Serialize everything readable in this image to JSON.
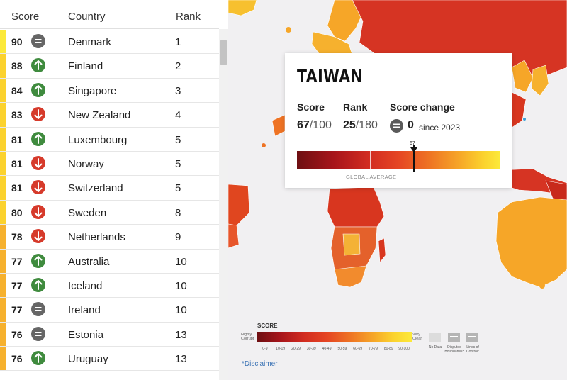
{
  "list": {
    "headers": {
      "score": "Score",
      "country": "Country",
      "rank": "Rank"
    },
    "rows": [
      {
        "score": "90",
        "trend": "same",
        "country": "Denmark",
        "rank": "1"
      },
      {
        "score": "88",
        "trend": "up",
        "country": "Finland",
        "rank": "2"
      },
      {
        "score": "84",
        "trend": "up",
        "country": "Singapore",
        "rank": "3"
      },
      {
        "score": "83",
        "trend": "down",
        "country": "New Zealand",
        "rank": "4"
      },
      {
        "score": "81",
        "trend": "up",
        "country": "Luxembourg",
        "rank": "5"
      },
      {
        "score": "81",
        "trend": "down",
        "country": "Norway",
        "rank": "5"
      },
      {
        "score": "81",
        "trend": "down",
        "country": "Switzerland",
        "rank": "5"
      },
      {
        "score": "80",
        "trend": "down",
        "country": "Sweden",
        "rank": "8"
      },
      {
        "score": "78",
        "trend": "down",
        "country": "Netherlands",
        "rank": "9"
      },
      {
        "score": "77",
        "trend": "up",
        "country": "Australia",
        "rank": "10"
      },
      {
        "score": "77",
        "trend": "up",
        "country": "Iceland",
        "rank": "10"
      },
      {
        "score": "77",
        "trend": "same",
        "country": "Ireland",
        "rank": "10"
      },
      {
        "score": "76",
        "trend": "same",
        "country": "Estonia",
        "rank": "13"
      },
      {
        "score": "76",
        "trend": "up",
        "country": "Uruguay",
        "rank": "13"
      }
    ],
    "trend_colors": {
      "up": "#3f8b3e",
      "down": "#d63a2b",
      "same": "#666666"
    }
  },
  "popup": {
    "country": "TAIWAN",
    "score_label": "Score",
    "score_value": "67",
    "score_max": "/100",
    "rank_label": "Rank",
    "rank_value": "25",
    "rank_max": "/180",
    "change_label": "Score change",
    "change_value": "0",
    "change_icon": "equals-icon",
    "since": "since 2023",
    "marker_value": "67",
    "average_label": "GLOBAL AVERAGE"
  },
  "legend": {
    "title": "SCORE",
    "low": "Highly Corrupt",
    "high": "Very Clean",
    "ranges": [
      "0-9",
      "10-19",
      "20-29",
      "30-39",
      "40-49",
      "50-59",
      "60-69",
      "70-79",
      "80-89",
      "90-100"
    ],
    "no_data": "No Data",
    "disputed": "Disputed Boundaries*",
    "lines_of_control": "Lines of Control*",
    "disclaimer": "*Disclaimer"
  },
  "colors": {
    "very_corrupt": "#6e0f12",
    "corrupt": "#d12b20",
    "mid": "#ee7324",
    "clean": "#fce93a",
    "map_background": "#f1f0f2"
  }
}
